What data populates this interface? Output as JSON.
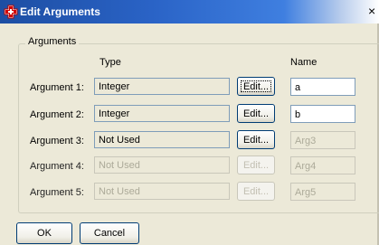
{
  "window": {
    "title": "Edit Arguments",
    "close_glyph": "×",
    "icon": "app-cross-icon"
  },
  "group": {
    "label": "Arguments"
  },
  "columns": {
    "type": "Type",
    "name": "Name"
  },
  "rows": [
    {
      "label": "Argument 1:",
      "type": "Integer",
      "edit": "Edit...",
      "name": "a",
      "enabled": true,
      "focused": true
    },
    {
      "label": "Argument 2:",
      "type": "Integer",
      "edit": "Edit...",
      "name": "b",
      "enabled": true,
      "focused": false
    },
    {
      "label": "Argument 3:",
      "type": "Not Used",
      "edit": "Edit...",
      "name": "Arg3",
      "enabled": true,
      "name_enabled": false
    },
    {
      "label": "Argument 4:",
      "type": "Not Used",
      "edit": "Edit...",
      "name": "Arg4",
      "enabled": false
    },
    {
      "label": "Argument 5:",
      "type": "Not Used",
      "edit": "Edit...",
      "name": "Arg5",
      "enabled": false
    }
  ],
  "buttons": {
    "ok": "OK",
    "cancel": "Cancel"
  }
}
